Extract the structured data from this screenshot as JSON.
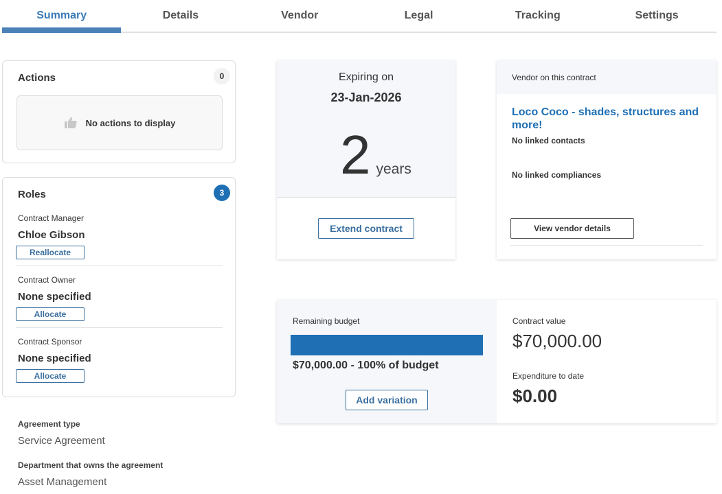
{
  "tabs": [
    {
      "label": "Summary",
      "active": true
    },
    {
      "label": "Details",
      "active": false
    },
    {
      "label": "Vendor",
      "active": false
    },
    {
      "label": "Legal",
      "active": false
    },
    {
      "label": "Tracking",
      "active": false
    },
    {
      "label": "Settings",
      "active": false
    }
  ],
  "actions": {
    "title": "Actions",
    "count": "0",
    "empty_icon": "thumbs-up-icon",
    "empty_text": "No actions to display"
  },
  "roles": {
    "title": "Roles",
    "count": "3",
    "items": [
      {
        "role": "Contract Manager",
        "name": "Chloe Gibson",
        "button": "Reallocate"
      },
      {
        "role": "Contract Owner",
        "name": "None specified",
        "button": "Allocate"
      },
      {
        "role": "Contract Sponsor",
        "name": "None specified",
        "button": "Allocate"
      }
    ]
  },
  "agreement": {
    "type_label": "Agreement type",
    "type_value": "Service Agreement",
    "dept_label": "Department that owns the agreement",
    "dept_value": "Asset Management"
  },
  "expiry": {
    "label": "Expiring on",
    "date": "23-Jan-2026",
    "number": "2",
    "unit": "years",
    "button": "Extend contract"
  },
  "vendor": {
    "header": "Vendor on this contract",
    "name": "Loco Coco - shades, structures and more!",
    "contacts": "No linked contacts",
    "compliances": "No linked compliances",
    "button": "View vendor details"
  },
  "budget": {
    "label": "Remaining budget",
    "remaining_fraction": 1.0,
    "summary": "$70,000.00 - 100% of budget",
    "button": "Add variation",
    "contract_value_label": "Contract value",
    "contract_value": "$70,000.00",
    "expenditure_label": "Expenditure to date",
    "expenditure": "$0.00"
  },
  "colors": {
    "accent": "#1f6fb5",
    "tab_active": "#3a7ab8",
    "link": "#1f6fb5",
    "panel_bg": "#f5f7fb"
  }
}
